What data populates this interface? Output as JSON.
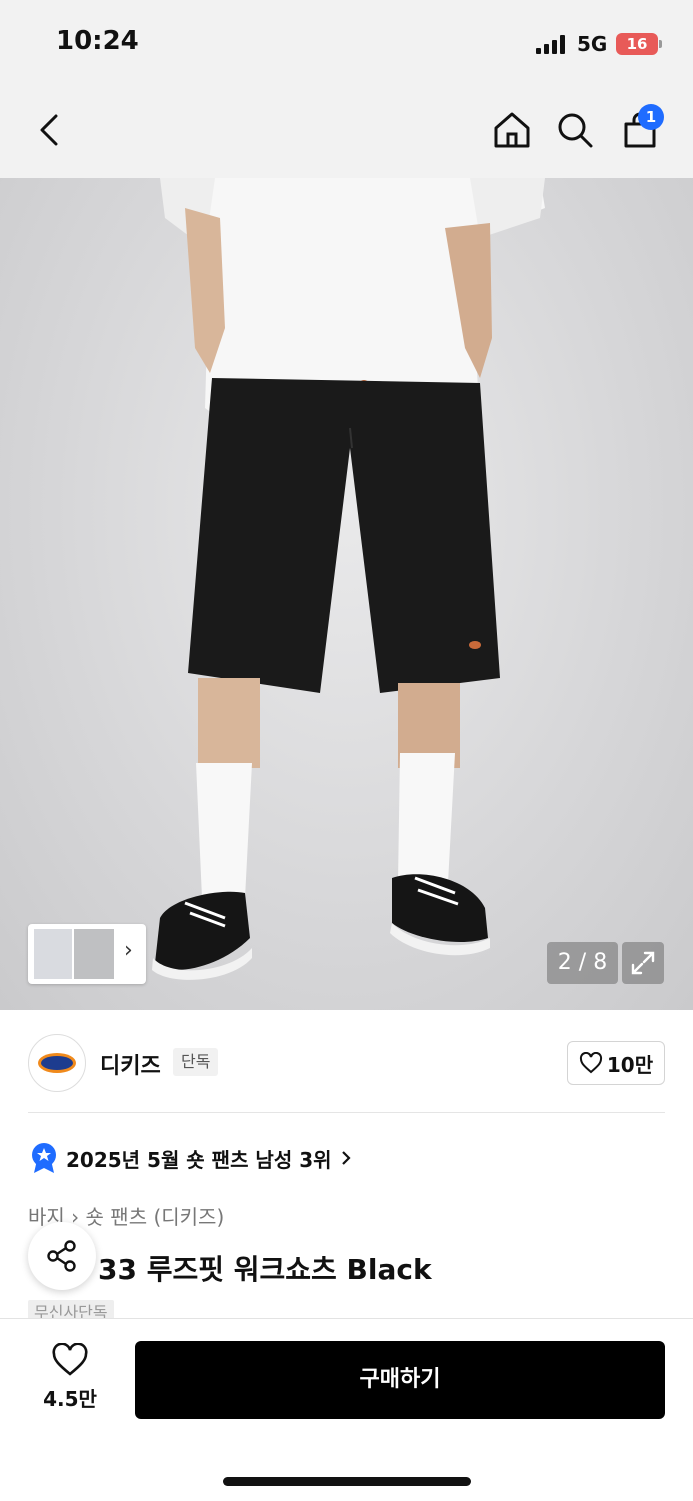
{
  "status_bar": {
    "time": "10:24",
    "network": "5G",
    "battery": "16"
  },
  "cart": {
    "badge": "1"
  },
  "gallery": {
    "current": 2,
    "total": 8,
    "counter_text": "2 / 8",
    "thumbnail_chevron": "›"
  },
  "brand": {
    "name": "디키즈",
    "tag": "단독",
    "likes": "10만"
  },
  "ranking": {
    "text": "2025년 5월 숏 팬츠 남성 3위"
  },
  "breadcrumb": {
    "category": "바지",
    "subcategory": "숏 팬츠 (디키즈)"
  },
  "product": {
    "title_visible": "33 루즈핏 워크쇼츠 Black",
    "partial_tag": "무신사단독"
  },
  "bottom_bar": {
    "wish_count": "4.5만",
    "buy_label": "구매하기"
  },
  "icons": [
    "back-icon",
    "home-icon",
    "search-icon",
    "cart-icon",
    "expand-icon",
    "heart-icon",
    "ranking-badge-icon",
    "chevron-right-icon",
    "share-icon"
  ],
  "colors": {
    "accent_blue": "#1f6cff",
    "buy_button": "#000000",
    "battery_low": "#e85a58"
  }
}
